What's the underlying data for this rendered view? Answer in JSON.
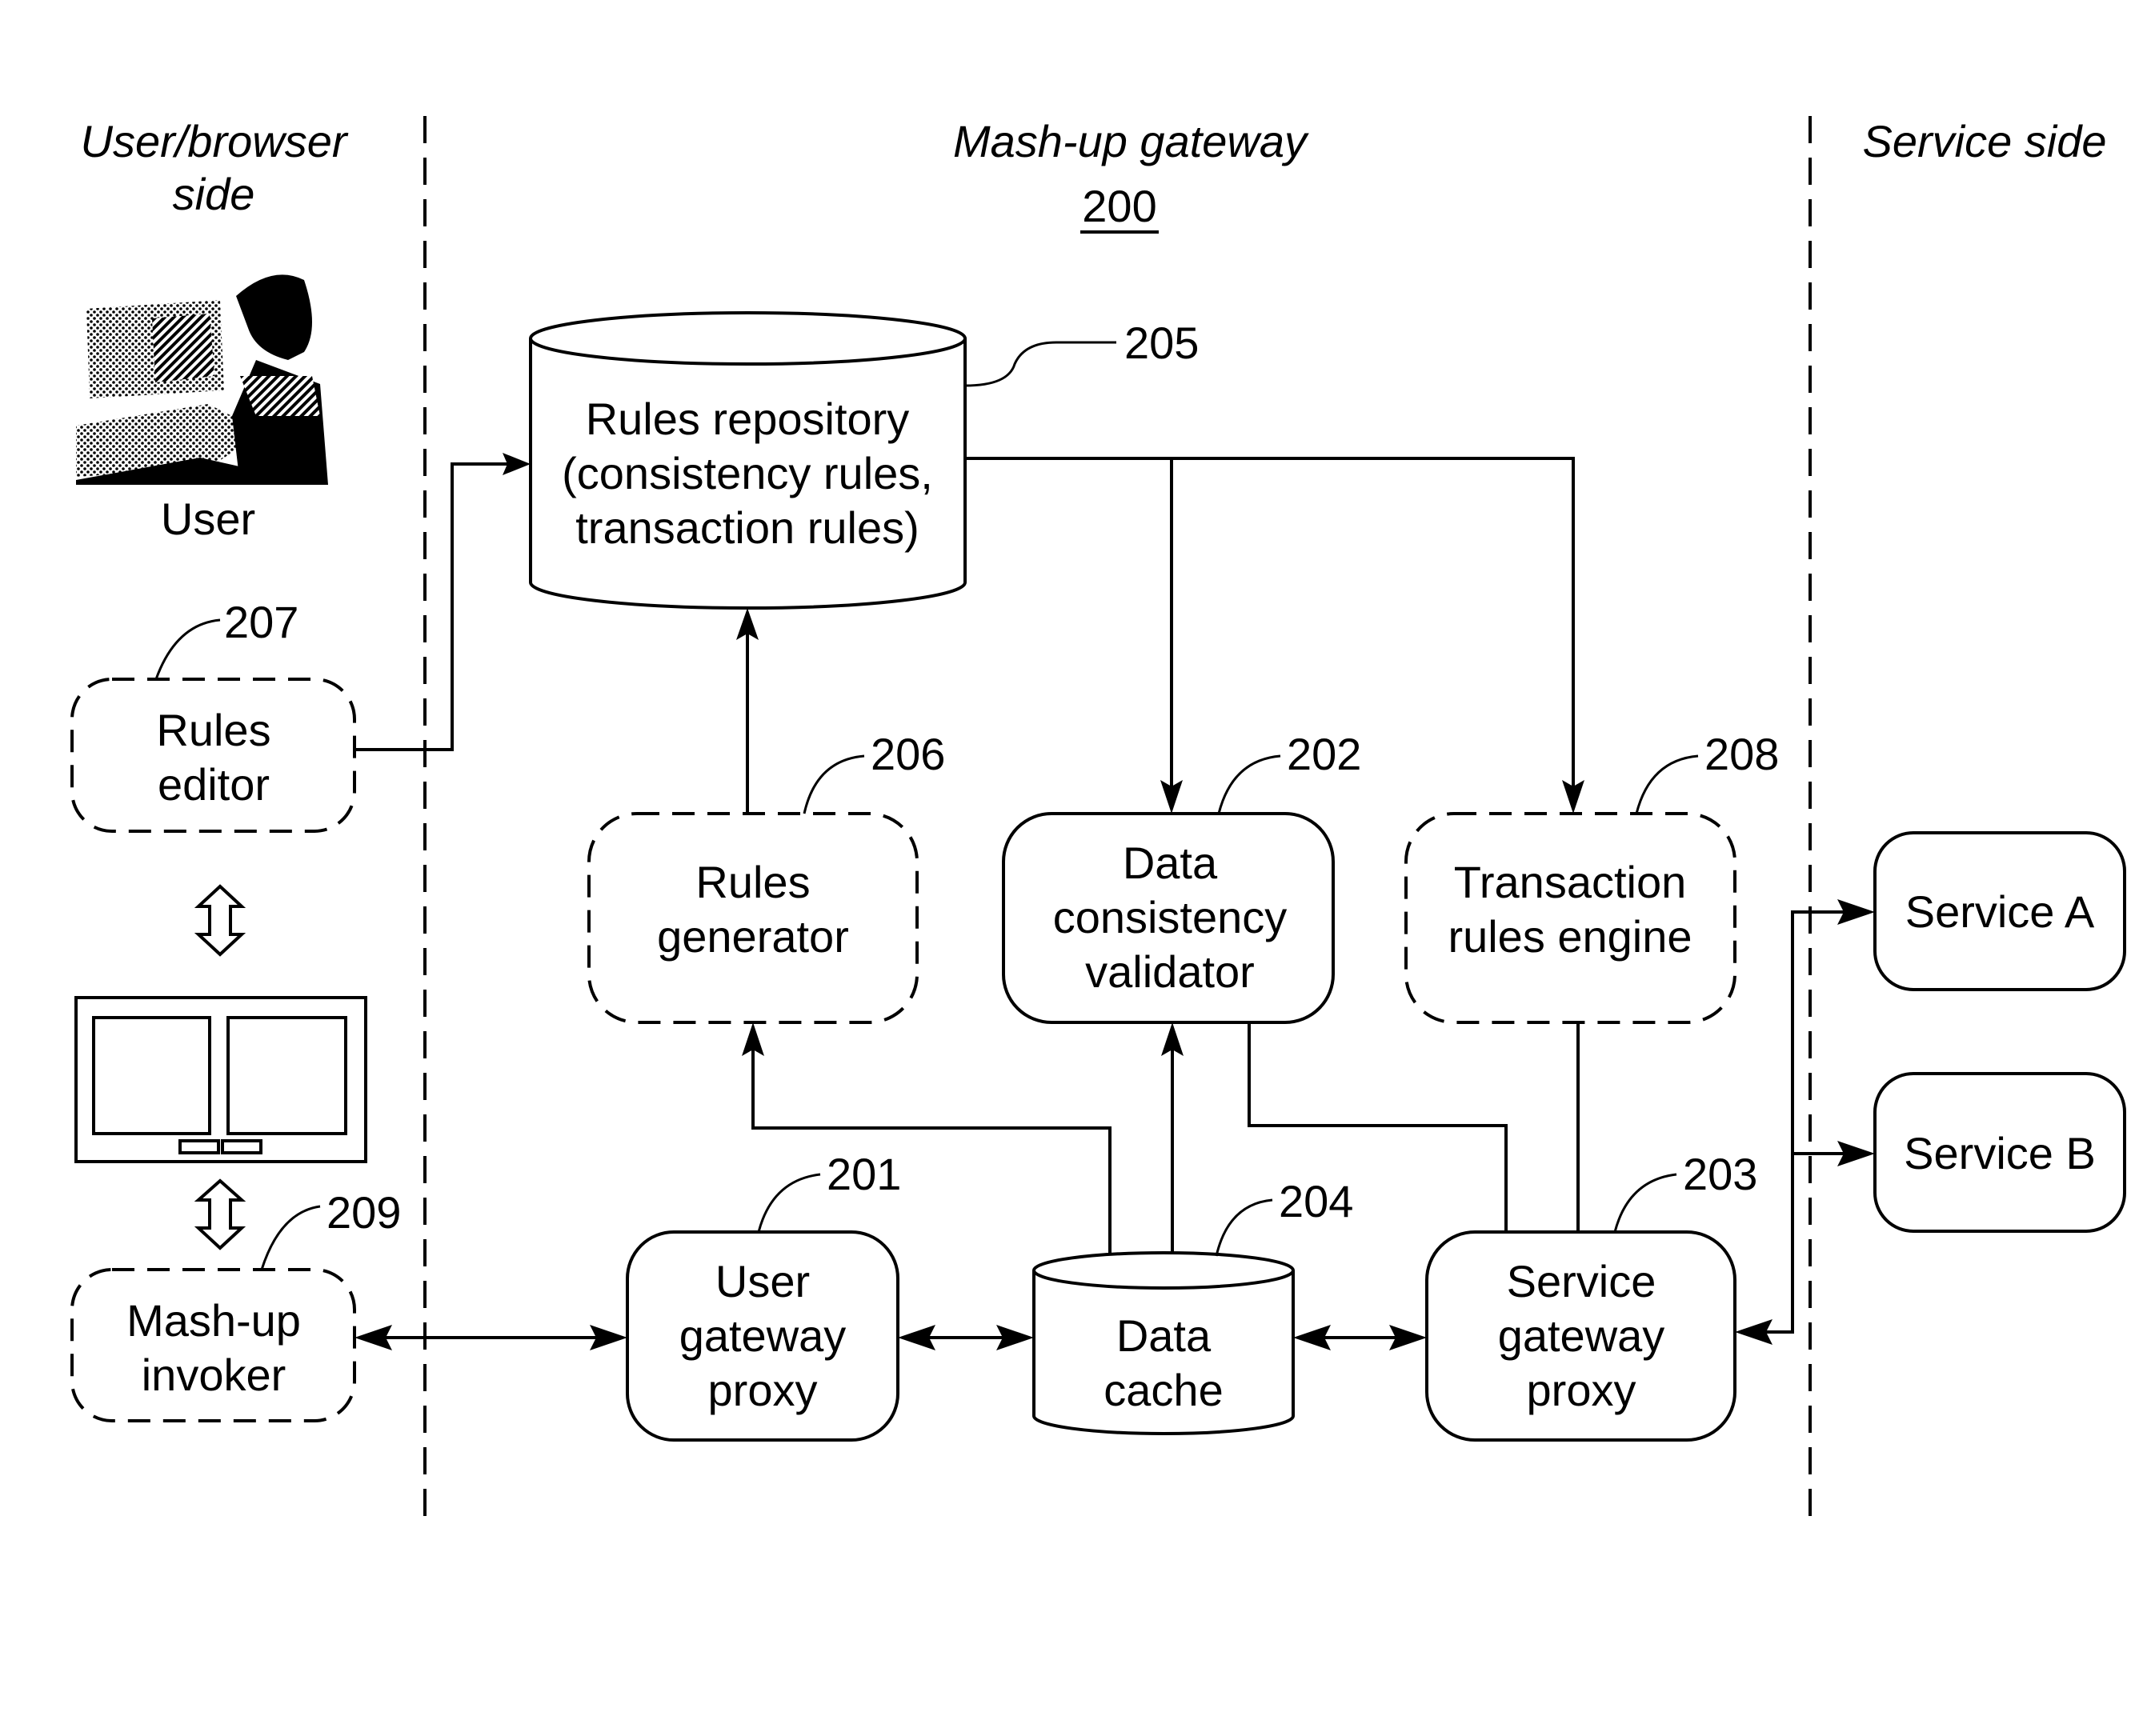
{
  "figure": {
    "regions": {
      "left": {
        "line1": "User/browser",
        "line2": "side"
      },
      "center": {
        "title": "Mash-up gateway",
        "ref": "200"
      },
      "right": {
        "title": "Service side"
      }
    },
    "user": {
      "label": "User",
      "icon": "person-at-computer-icon"
    },
    "screen_icon": "browser-window-icon",
    "components": {
      "rules_repository": {
        "lines": [
          "Rules repository",
          "(consistency rules,",
          "transaction rules)"
        ],
        "ref": "205",
        "shape": "cylinder"
      },
      "rules_editor": {
        "lines": [
          "Rules",
          "editor"
        ],
        "ref": "207",
        "style": "dashed"
      },
      "mashup_invoker": {
        "lines": [
          "Mash-up",
          "invoker"
        ],
        "ref": "209",
        "style": "dashed"
      },
      "rules_generator": {
        "lines": [
          "Rules",
          "generator"
        ],
        "ref": "206",
        "style": "dashed"
      },
      "data_consistency_validator": {
        "lines": [
          "Data",
          "consistency",
          "validator"
        ],
        "ref": "202",
        "style": "solid"
      },
      "transaction_rules_engine": {
        "lines": [
          "Transaction",
          "rules engine"
        ],
        "ref": "208",
        "style": "dashed"
      },
      "user_gateway_proxy": {
        "lines": [
          "User",
          "gateway",
          "proxy"
        ],
        "ref": "201",
        "style": "solid"
      },
      "data_cache": {
        "lines": [
          "Data",
          "cache"
        ],
        "ref": "204",
        "shape": "cylinder"
      },
      "service_gateway_proxy": {
        "lines": [
          "Service",
          "gateway",
          "proxy"
        ],
        "ref": "203",
        "style": "solid"
      },
      "service_a": {
        "lines": [
          "Service A"
        ]
      },
      "service_b": {
        "lines": [
          "Service B"
        ]
      }
    },
    "connections": [
      {
        "from": "rules_editor",
        "to": "rules_repository",
        "type": "arrow"
      },
      {
        "from": "rules_generator",
        "to": "rules_repository",
        "type": "arrow"
      },
      {
        "from": "rules_repository",
        "to": "data_consistency_validator",
        "type": "arrow"
      },
      {
        "from": "rules_repository",
        "to": "transaction_rules_engine",
        "type": "arrow"
      },
      {
        "from": "data_cache",
        "to": "rules_generator",
        "type": "arrow"
      },
      {
        "from": "data_cache",
        "to": "data_consistency_validator",
        "type": "arrow"
      },
      {
        "from": "data_consistency_validator",
        "to": "service_gateway_proxy",
        "type": "line"
      },
      {
        "from": "transaction_rules_engine",
        "to": "service_gateway_proxy",
        "type": "line"
      },
      {
        "from": "mashup_invoker",
        "to": "user_gateway_proxy",
        "type": "bidirectional"
      },
      {
        "from": "user_gateway_proxy",
        "to": "data_cache",
        "type": "bidirectional"
      },
      {
        "from": "data_cache",
        "to": "service_gateway_proxy",
        "type": "bidirectional"
      },
      {
        "from": "service_gateway_proxy",
        "to": "service_a",
        "type": "bidirectional"
      },
      {
        "from": "service_gateway_proxy",
        "to": "service_b",
        "type": "bidirectional"
      },
      {
        "from": "rules_editor",
        "to": "browser_window",
        "type": "hollow-bidirectional"
      },
      {
        "from": "browser_window",
        "to": "mashup_invoker",
        "type": "hollow-bidirectional"
      }
    ]
  }
}
